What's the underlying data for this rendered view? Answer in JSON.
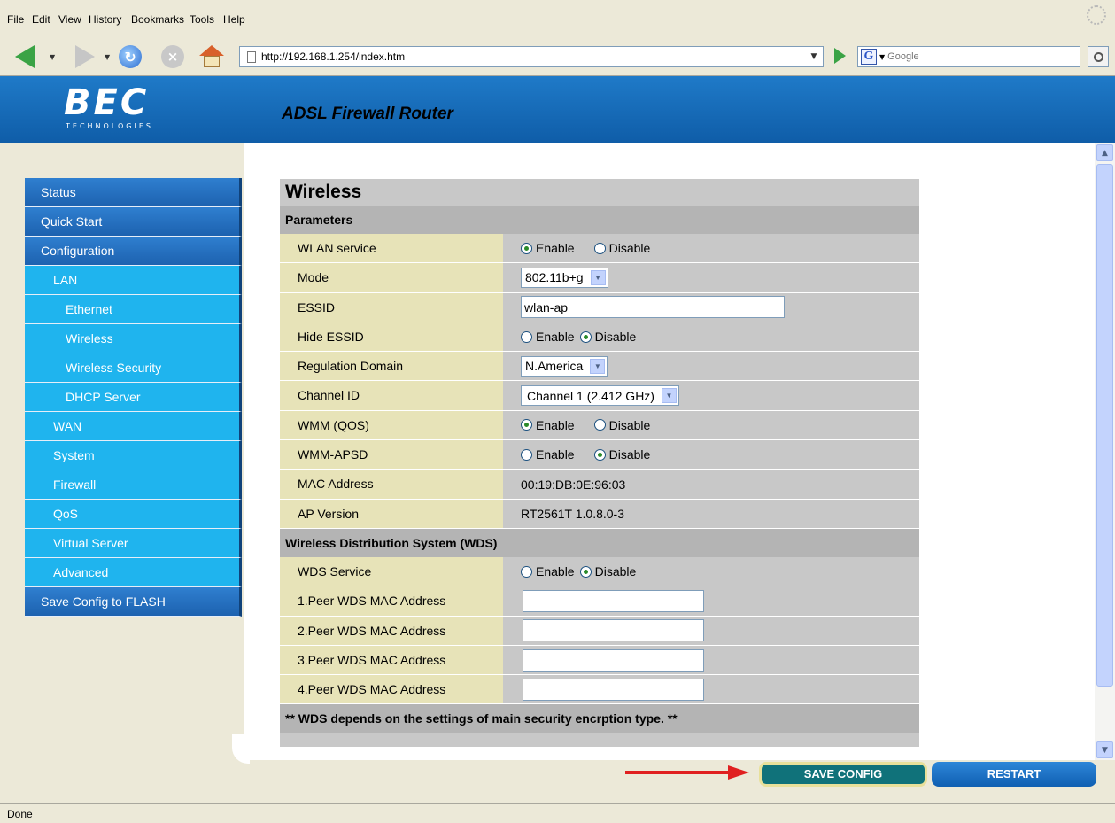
{
  "browser": {
    "menu": [
      "File",
      "Edit",
      "View",
      "History",
      "Bookmarks",
      "Tools",
      "Help"
    ],
    "url": "http://192.168.1.254/index.htm",
    "search_placeholder": "Google",
    "status": "Done"
  },
  "header": {
    "logo": "BEC",
    "logo_sub": "TECHNOLOGIES",
    "product": "ADSL Firewall Router"
  },
  "sidebar": {
    "items": [
      {
        "label": "Status",
        "level": 1
      },
      {
        "label": "Quick Start",
        "level": 1
      },
      {
        "label": "Configuration",
        "level": 1
      },
      {
        "label": "LAN",
        "level": 2
      },
      {
        "label": "Ethernet",
        "level": 3
      },
      {
        "label": "Wireless",
        "level": 3
      },
      {
        "label": "Wireless Security",
        "level": 3
      },
      {
        "label": "DHCP Server",
        "level": 3
      },
      {
        "label": "WAN",
        "level": 2
      },
      {
        "label": "System",
        "level": 2
      },
      {
        "label": "Firewall",
        "level": 2
      },
      {
        "label": "QoS",
        "level": 2
      },
      {
        "label": "Virtual Server",
        "level": 2
      },
      {
        "label": "Advanced",
        "level": 2
      },
      {
        "label": "Save Config to FLASH",
        "level": 1
      }
    ]
  },
  "main": {
    "title": "Wireless",
    "sections": {
      "parameters": "Parameters",
      "wds": "Wireless Distribution System (WDS)"
    },
    "radio": {
      "enable": "Enable",
      "disable": "Disable"
    },
    "params": {
      "wlan_service": {
        "label": "WLAN service",
        "selected": "Enable"
      },
      "mode": {
        "label": "Mode",
        "value": "802.11b+g"
      },
      "essid": {
        "label": "ESSID",
        "value": "wlan-ap"
      },
      "hide_essid": {
        "label": "Hide ESSID",
        "selected": "Disable"
      },
      "regulation_domain": {
        "label": "Regulation Domain",
        "value": "N.America"
      },
      "channel_id": {
        "label": "Channel ID",
        "value": "Channel 1 (2.412 GHz)"
      },
      "wmm": {
        "label": "WMM (QOS)",
        "selected": "Enable"
      },
      "wmm_apsd": {
        "label": "WMM-APSD",
        "selected": "Disable"
      },
      "mac_address": {
        "label": "MAC Address",
        "value": "00:19:DB:0E:96:03"
      },
      "ap_version": {
        "label": "AP Version",
        "value": "RT2561T 1.0.8.0-3"
      }
    },
    "wds": {
      "service": {
        "label": "WDS Service",
        "selected": "Disable"
      },
      "peers": [
        {
          "label": "1.Peer WDS MAC Address",
          "value": ""
        },
        {
          "label": "2.Peer WDS MAC Address",
          "value": ""
        },
        {
          "label": "3.Peer WDS MAC Address",
          "value": ""
        },
        {
          "label": "4.Peer WDS MAC Address",
          "value": ""
        }
      ]
    },
    "note": "** WDS depends on the settings of main security encrption type. **"
  },
  "actions": {
    "save": "SAVE CONFIG",
    "restart": "RESTART"
  },
  "colors": {
    "header_blue": "#1f7ac8",
    "nav_blue": "#2f7fd0",
    "nav_cyan": "#1fb4ee",
    "label_cell": "#e7e3b8",
    "value_cell": "#c8c8c8",
    "save_button": "#10727a",
    "arrow_red": "#e02020"
  }
}
